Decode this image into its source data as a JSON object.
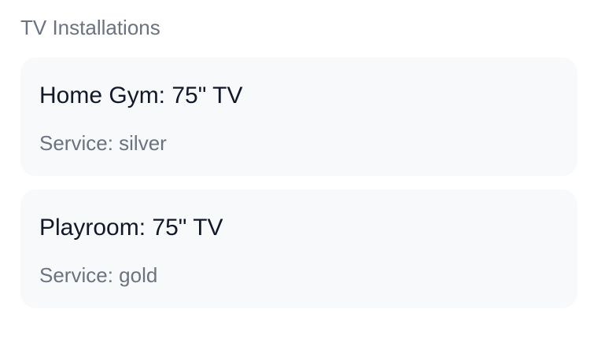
{
  "section": {
    "title": "TV Installations"
  },
  "installations": [
    {
      "title": "Home Gym: 75\" TV",
      "service": "Service: silver"
    },
    {
      "title": "Playroom: 75\" TV",
      "service": "Service: gold"
    }
  ],
  "colors": {
    "card_background": "#f8f9fb",
    "title_text": "#111827",
    "muted_text": "#6b7280"
  }
}
